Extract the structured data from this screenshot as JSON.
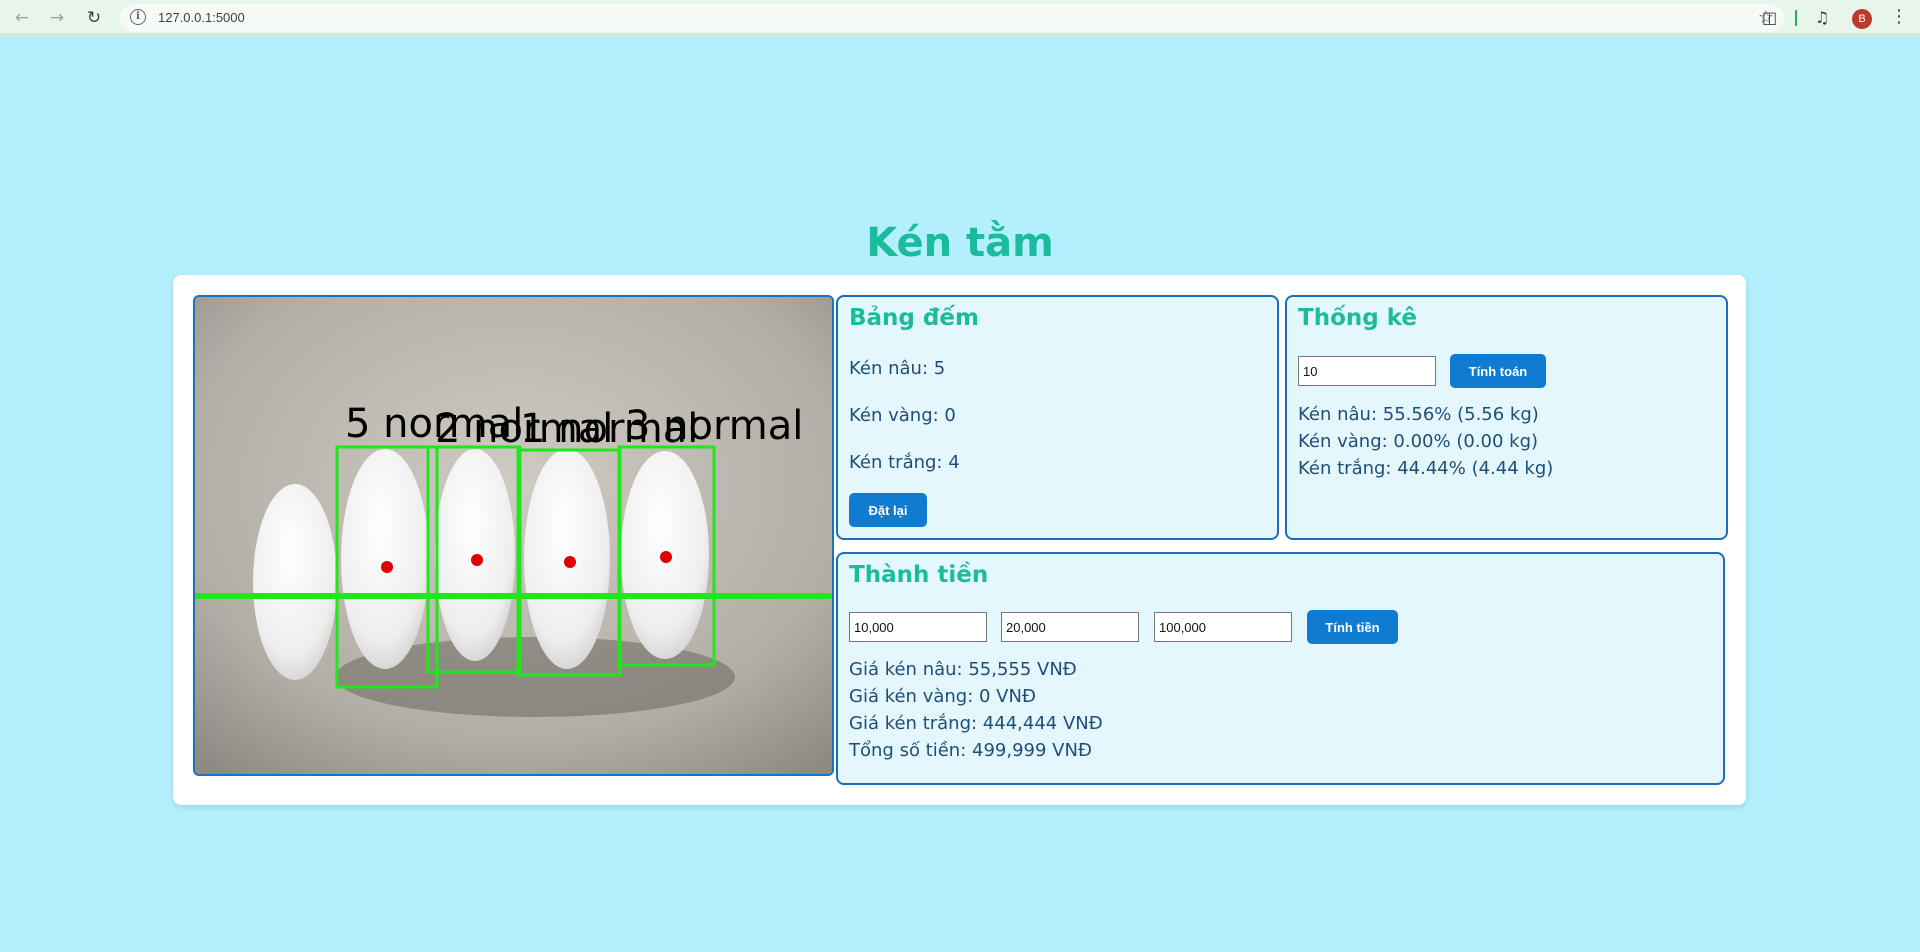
{
  "browser": {
    "url": "127.0.0.1:5000",
    "profile_initial": "B",
    "icons": [
      "back-icon",
      "forward-icon",
      "reload-icon",
      "site-info-icon",
      "bookmark-star-icon",
      "extensions-icon",
      "media-control-icon",
      "menu-icon"
    ]
  },
  "page": {
    "title": "Kén tằm"
  },
  "image": {
    "detections": [
      {
        "label": "5 normal"
      },
      {
        "label": "2 normal"
      },
      {
        "label": "1 normal"
      },
      {
        "label": "3 normal"
      }
    ]
  },
  "counts": {
    "title": "Bảng đếm",
    "brown": "Kén nâu: 5",
    "yellow": "Kén vàng: 0",
    "white": "Kén trắng: 4",
    "reset_label": "Đặt lại"
  },
  "stats": {
    "title": "Thống kê",
    "weight_value": "10",
    "calc_label": "Tính toán",
    "brown": "Kén nâu: 55.56% (5.56 kg)",
    "yellow": "Kén vàng: 0.00% (0.00 kg)",
    "white": "Kén trắng: 44.44% (4.44 kg)"
  },
  "price": {
    "title": "Thành tiền",
    "brown_price": "10,000",
    "yellow_price": "20,000",
    "white_price": "100,000",
    "calc_label": "Tính tiền",
    "brown_total": "Giá kén nâu: 55,555 VNĐ",
    "yellow_total": "Giá kén vàng: 0 VNĐ",
    "white_total": "Giá kén trắng: 444,444 VNĐ",
    "grand_total": "Tổng số tiền: 499,999 VNĐ"
  },
  "colors": {
    "background": "#b3effd",
    "title": "#1abc9c",
    "panel_border": "#1a6fb8",
    "panel_bg": "#e4f7fd",
    "button": "#0f7bd1",
    "detect_box": "#22e61d",
    "centroid": "#e00000"
  }
}
